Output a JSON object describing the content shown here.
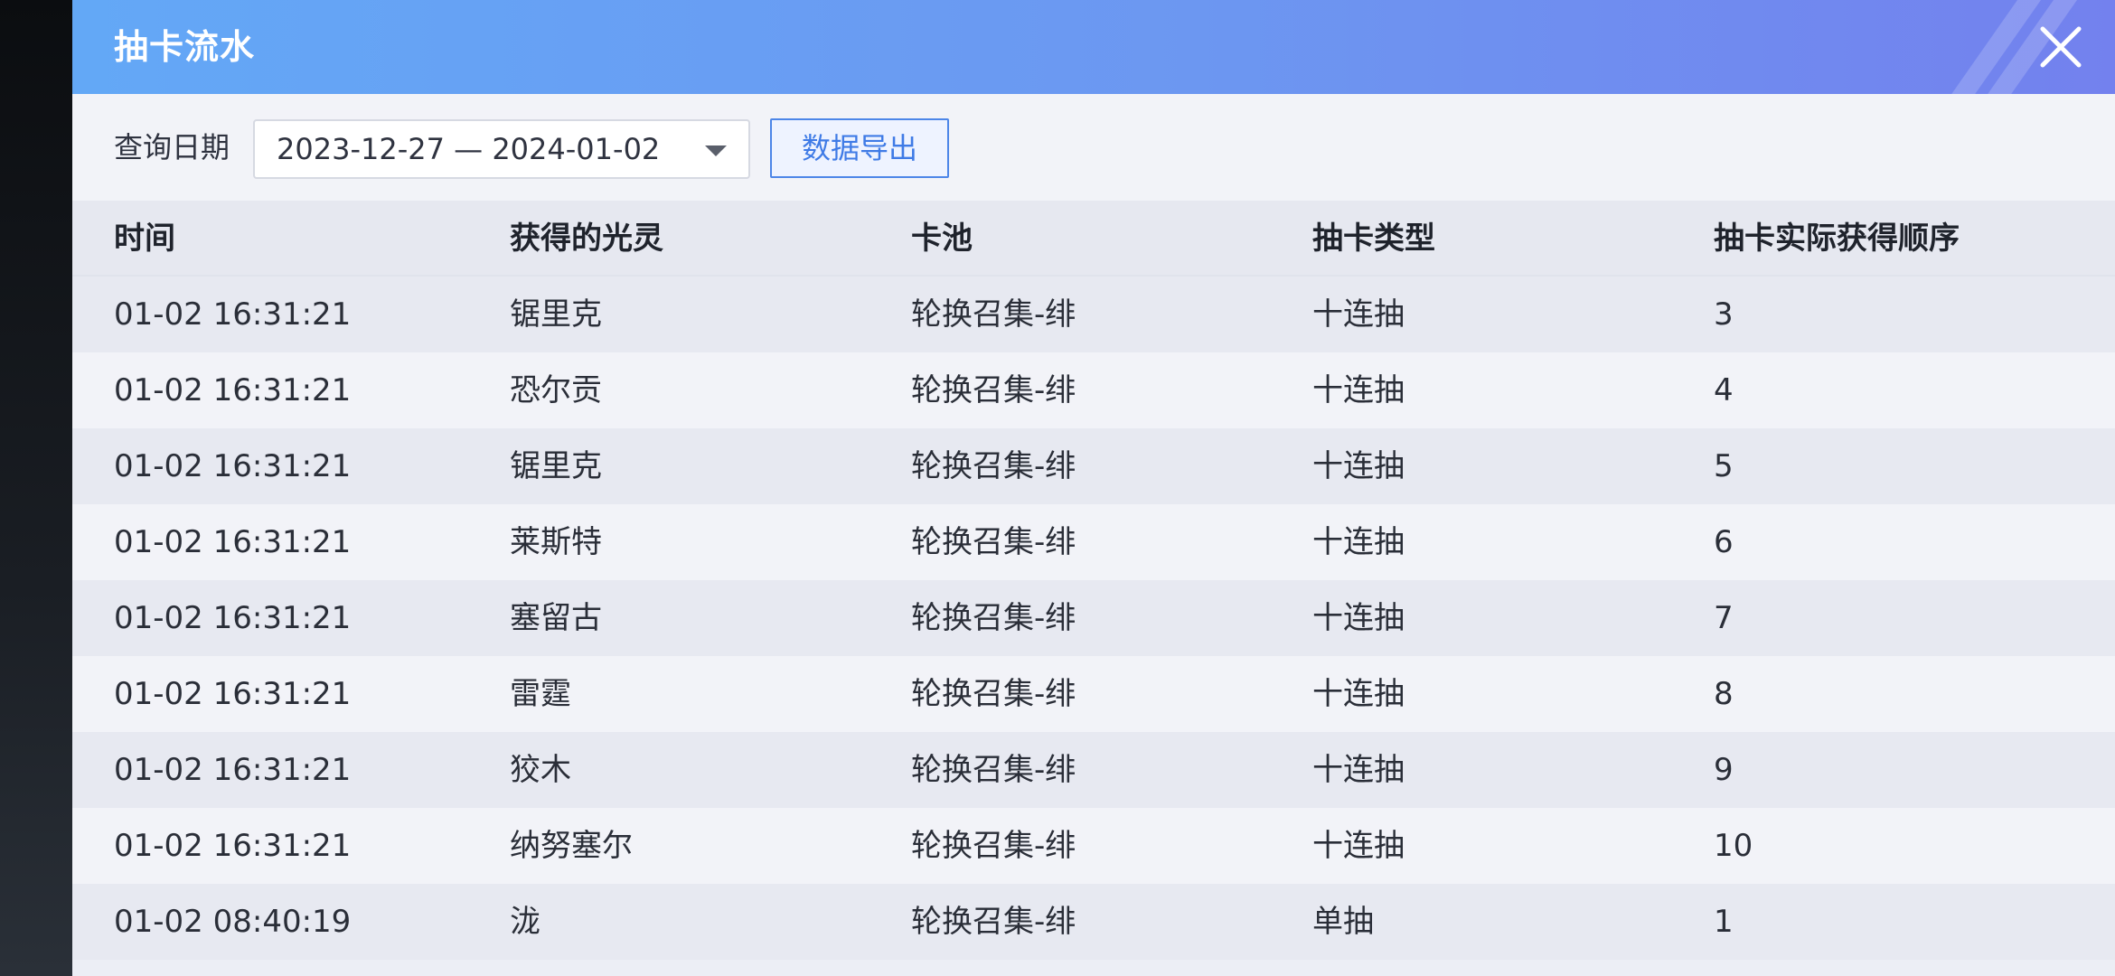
{
  "title": "抽卡流水",
  "toolbar": {
    "query_label": "查询日期",
    "date_range": "2023-12-27 — 2024-01-02",
    "export_label": "数据导出"
  },
  "table": {
    "headers": [
      "时间",
      "获得的光灵",
      "卡池",
      "抽卡类型",
      "抽卡实际获得顺序"
    ],
    "rows": [
      [
        "01-02 16:31:21",
        "锯里克",
        "轮换召集-绯",
        "十连抽",
        "3"
      ],
      [
        "01-02 16:31:21",
        "恐尔贡",
        "轮换召集-绯",
        "十连抽",
        "4"
      ],
      [
        "01-02 16:31:21",
        "锯里克",
        "轮换召集-绯",
        "十连抽",
        "5"
      ],
      [
        "01-02 16:31:21",
        "莱斯特",
        "轮换召集-绯",
        "十连抽",
        "6"
      ],
      [
        "01-02 16:31:21",
        "塞留古",
        "轮换召集-绯",
        "十连抽",
        "7"
      ],
      [
        "01-02 16:31:21",
        "雷霆",
        "轮换召集-绯",
        "十连抽",
        "8"
      ],
      [
        "01-02 16:31:21",
        "狡木",
        "轮换召集-绯",
        "十连抽",
        "9"
      ],
      [
        "01-02 16:31:21",
        "纳努塞尔",
        "轮换召集-绯",
        "十连抽",
        "10"
      ],
      [
        "01-02 08:40:19",
        "泷",
        "轮换召集-绯",
        "单抽",
        "1"
      ]
    ]
  },
  "icons": {
    "close": "close-icon",
    "caret": "caret-down-icon"
  },
  "colors": {
    "title_gradient_start": "#63a8f6",
    "title_gradient_end": "#7381ee",
    "accent": "#3f7be6"
  }
}
